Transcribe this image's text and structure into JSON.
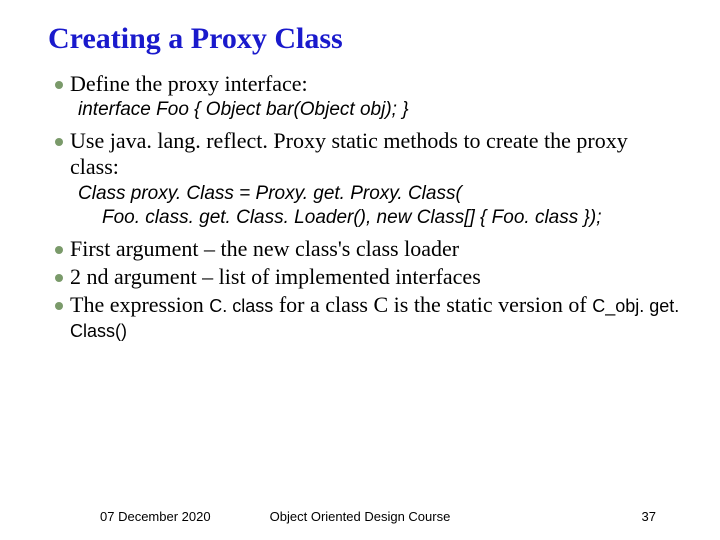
{
  "title": "Creating a Proxy Class",
  "bullets": {
    "b0": "Define the proxy interface:",
    "b1": "Use java. lang. reflect. Proxy static methods to create the proxy class:",
    "b2": "First argument – the new class's class loader",
    "b3": "2 nd argument – list of implemented interfaces",
    "b4_pre": "The expression ",
    "b4_code1": "C. class",
    "b4_mid": " for a class C is the static version of ",
    "b4_code2": "C_obj. get. Class()"
  },
  "code": {
    "c0": "interface Foo { Object bar(Object obj); }",
    "c1": "Class proxy. Class = Proxy. get. Proxy. Class(",
    "c2": "Foo. class. get. Class. Loader(), new Class[] { Foo. class });"
  },
  "footer": {
    "date": "07 December 2020",
    "course": "Object Oriented Design Course",
    "page": "37"
  }
}
